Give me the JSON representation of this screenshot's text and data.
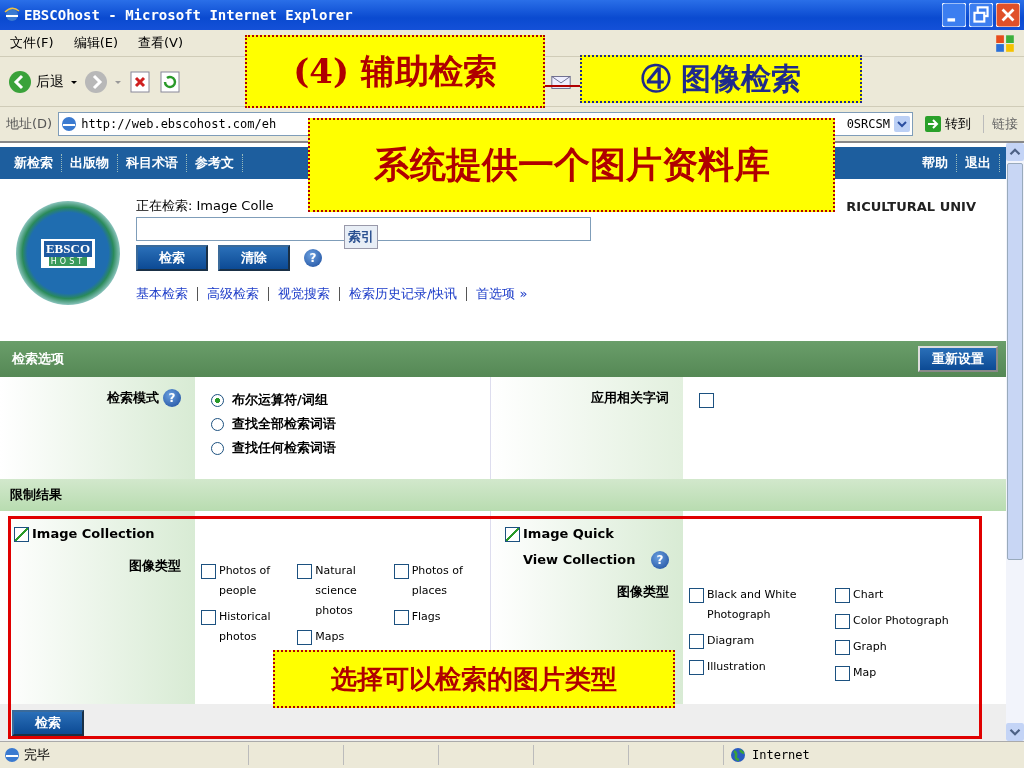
{
  "window": {
    "title": "EBSCOhost - Microsoft Internet Explorer"
  },
  "menu": [
    "文件(F)",
    "编辑(E)",
    "查看(V)"
  ],
  "toolbar": {
    "back": "后退"
  },
  "address": {
    "label": "地址(D)",
    "url": "http://web.ebscohost.com/eh",
    "url_end": "0SRCSM",
    "go": "转到",
    "links": "链接"
  },
  "nav": {
    "left": [
      "新检索",
      "出版物",
      "科目术语",
      "参考文"
    ],
    "right": [
      "帮助",
      "退出"
    ]
  },
  "header": {
    "logo": [
      "EBSCO",
      "HOST"
    ],
    "searching": "正在检索: Image Colle",
    "tooltip": "索引",
    "org": "RICULTURAL UNIV",
    "buttons": [
      "检索",
      "清除"
    ],
    "help": "?",
    "links": [
      "基本检索",
      "高级检索",
      "视觉搜索",
      "检索历史记录/快讯",
      "首选项 »"
    ]
  },
  "options": {
    "title": "检索选项",
    "reset": "重新设置",
    "mode_label": "检索模式",
    "mode_help": "?",
    "modes": [
      {
        "label": "布尔运算符/词组",
        "selected": true
      },
      {
        "label": "查找全部检索词语",
        "selected": false
      },
      {
        "label": "查找任何检索词语",
        "selected": false
      }
    ],
    "related_label": "应用相关字词",
    "related_checked": false
  },
  "limit": {
    "title": "限制结果",
    "collections": [
      {
        "name": "Image Collection",
        "checked": true,
        "type_label": "图像类型",
        "type_columns": [
          [
            {
              "label": "Photos of people",
              "checked": false
            },
            {
              "label": "Historical photos",
              "checked": false
            }
          ],
          [
            {
              "label": "Natural science photos",
              "checked": false
            },
            {
              "label": "Maps",
              "checked": false
            }
          ],
          [
            {
              "label": "Photos of places",
              "checked": false
            },
            {
              "label": "Flags",
              "checked": false
            }
          ]
        ]
      },
      {
        "name": "Image Quick View Collection",
        "checked": true,
        "help": "?",
        "type_label": "图像类型",
        "type_columns": [
          [
            {
              "label": "Black and White Photograph",
              "checked": false
            },
            {
              "label": "Diagram",
              "checked": false
            },
            {
              "label": "Illustration",
              "checked": false
            }
          ],
          [
            {
              "label": "Chart",
              "checked": false
            },
            {
              "label": "Color Photograph",
              "checked": false
            },
            {
              "label": "Graph",
              "checked": false
            },
            {
              "label": "Map",
              "checked": false
            }
          ]
        ]
      }
    ],
    "search_button": "检索"
  },
  "status": {
    "text": "完毕",
    "zone": "Internet"
  },
  "callouts": [
    {
      "text": "(4) 辅助检索",
      "color": "#b00000"
    },
    {
      "text": "④ 图像检索",
      "color": "#1f2a8c"
    },
    {
      "text": "系统提供一个图片资料库",
      "color": "#b00000"
    },
    {
      "text": "选择可以检索的图片类型",
      "color": "#b00000"
    }
  ]
}
